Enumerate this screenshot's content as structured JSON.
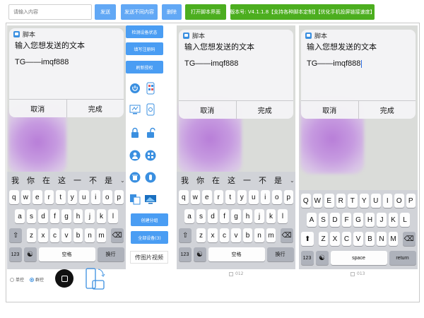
{
  "toolbar": {
    "input_placeholder": "请输入内容",
    "send": "发送",
    "send_diff": "发送不同内容",
    "delete": "删除",
    "open_script": "打开脚本界面",
    "version": "版本号: V4.1.1.8【支持各种脚本定制】【优化手机投屏链接速度】"
  },
  "dialog": {
    "app_name": "脚本",
    "title": "输入您想发送的文本",
    "text": "TG——imqf888",
    "cancel": "取消",
    "confirm": "完成"
  },
  "keyboard_zh": {
    "candidates": [
      "我",
      "你",
      "在",
      "这",
      "一",
      "不",
      "是"
    ],
    "row1": [
      "q",
      "w",
      "e",
      "r",
      "t",
      "y",
      "u",
      "i",
      "o",
      "p"
    ],
    "row2": [
      "a",
      "s",
      "d",
      "f",
      "g",
      "h",
      "j",
      "k",
      "l"
    ],
    "row3": [
      "z",
      "x",
      "c",
      "v",
      "b",
      "n",
      "m"
    ],
    "num": "123",
    "space": "空格",
    "return": "换行"
  },
  "keyboard_en": {
    "row1": [
      "Q",
      "W",
      "E",
      "R",
      "T",
      "Y",
      "U",
      "I",
      "O",
      "P"
    ],
    "row2": [
      "A",
      "S",
      "D",
      "F",
      "G",
      "H",
      "J",
      "K",
      "L"
    ],
    "row3": [
      "Z",
      "X",
      "C",
      "V",
      "B",
      "N",
      "M"
    ],
    "num": "123",
    "space": "space",
    "return": "return"
  },
  "controls": {
    "check_device": "检测设备状态",
    "fill_reg": "填写注册码",
    "refresh_auth": "刷新授权",
    "create_group": "创建分组",
    "all_devices": "全部设备(3)",
    "send_image_video": "传图片视频"
  },
  "mode": {
    "single": "单控",
    "group": "群控"
  },
  "devices": [
    {
      "label": "012"
    },
    {
      "label": "013"
    }
  ],
  "colors": {
    "blue": "#62a8f5",
    "green": "#4cae1f",
    "accent": "#3a8fe0"
  }
}
